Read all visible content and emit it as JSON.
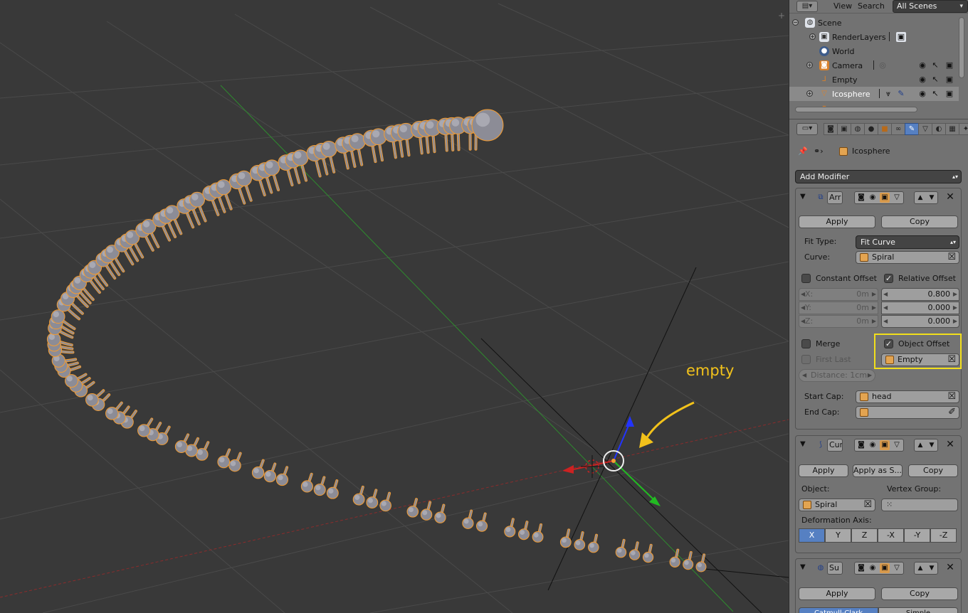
{
  "viewport": {
    "annotation": "empty",
    "colors": {
      "background": "#393939",
      "grid": "#4a4a4a",
      "x_axis": "#8b2c2c",
      "y_axis": "#2e8b2e",
      "selection_outline": "#f39c32",
      "annotation": "#f2c21b"
    }
  },
  "outliner": {
    "menu": {
      "view": "View",
      "search": "Search",
      "scenes": "All Scenes"
    },
    "rows": [
      {
        "label": "Scene",
        "icon": "scene-icon"
      },
      {
        "label": "RenderLayers",
        "icon": "render-layers-icon"
      },
      {
        "label": "World",
        "icon": "world-icon"
      },
      {
        "label": "Camera",
        "icon": "camera-icon"
      },
      {
        "label": "Empty",
        "icon": "empty-icon"
      },
      {
        "label": "Icosphere",
        "icon": "mesh-icon",
        "selected": true
      }
    ]
  },
  "properties": {
    "breadcrumb": {
      "object": "Icosphere"
    },
    "add_modifier": "Add Modifier",
    "array": {
      "name": "Arr",
      "apply": "Apply",
      "copy": "Copy",
      "fit_type_label": "Fit Type:",
      "fit_type": "Fit Curve",
      "curve_label": "Curve:",
      "curve": "Spiral",
      "constant_offset": "Constant Offset",
      "relative_offset": "Relative Offset",
      "const": {
        "x_label": "X:",
        "x": "0m",
        "y_label": "Y:",
        "y": "0m",
        "z_label": "Z:",
        "z": "0m"
      },
      "rel": {
        "x": "0.800",
        "y": "0.000",
        "z": "0.000"
      },
      "merge": "Merge",
      "first_last": "First Last",
      "distance": "Distance: 1cm",
      "object_offset": "Object Offset",
      "offset_object": "Empty",
      "start_cap_label": "Start Cap:",
      "start_cap": "head",
      "end_cap_label": "End Cap:",
      "end_cap": ""
    },
    "curve_mod": {
      "name": "Cur",
      "apply": "Apply",
      "apply_shape": "Apply as S...",
      "copy": "Copy",
      "object_label": "Object:",
      "object": "Spiral",
      "vgroup_label": "Vertex Group:",
      "deform_label": "Deformation Axis:",
      "axes": [
        "X",
        "Y",
        "Z",
        "-X",
        "-Y",
        "-Z"
      ],
      "active_axis": "X"
    },
    "subsurf": {
      "name": "Su",
      "apply": "Apply",
      "copy": "Copy",
      "tab_catmull": "Catmull-Clark",
      "tab_simple": "Simple"
    }
  }
}
